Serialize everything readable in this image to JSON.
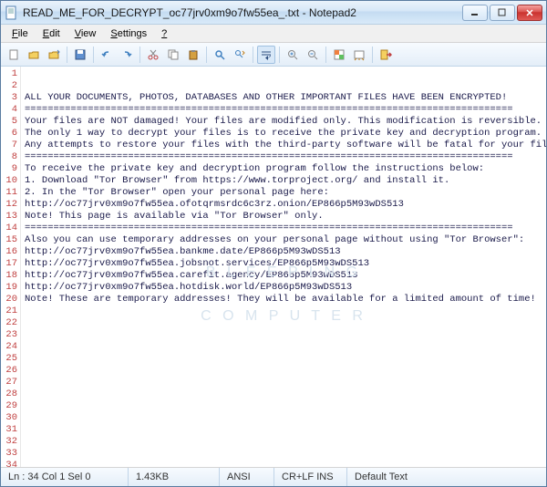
{
  "window": {
    "title": "READ_ME_FOR_DECRYPT_oc77jrv0xm9o7fw55ea_.txt - Notepad2"
  },
  "menu": {
    "file": "File",
    "edit": "Edit",
    "view": "View",
    "settings": "Settings",
    "help": "?"
  },
  "toolbar_icons": {
    "new": "new-icon",
    "open": "open-icon",
    "history": "history-icon",
    "save": "save-icon",
    "undo": "undo-icon",
    "redo": "redo-icon",
    "cut": "cut-icon",
    "copy": "copy-icon",
    "paste": "paste-icon",
    "find": "find-icon",
    "replace": "replace-icon",
    "wrap": "wrap-icon",
    "zoomin": "zoomin-icon",
    "zoomout": "zoomout-icon",
    "scheme": "scheme-icon",
    "config": "config-icon",
    "exit": "exit-icon"
  },
  "lines": [
    "ALL YOUR DOCUMENTS, PHOTOS, DATABASES AND OTHER IMPORTANT FILES HAVE BEEN ENCRYPTED!",
    "",
    "=====================================================================================",
    "Your files are NOT damaged! Your files are modified only. This modification is reversible.",
    "",
    "The only 1 way to decrypt your files is to receive the private key and decryption program.",
    "",
    "Any attempts to restore your files with the third-party software will be fatal for your files!",
    "",
    "=====================================================================================",
    "To receive the private key and decryption program follow the instructions below:",
    "",
    "1. Download \"Tor Browser\" from https://www.torproject.org/ and install it.",
    "",
    "2. In the \"Tor Browser\" open your personal page here:",
    "",
    "",
    "http://oc77jrv0xm9o7fw55ea.ofotqrmsrdc6c3rz.onion/EP866p5M93wDS513",
    "",
    "",
    "Note! This page is available via \"Tor Browser\" only.",
    "",
    "=====================================================================================",
    "Also you can use temporary addresses on your personal page without using \"Tor Browser\":",
    "",
    "",
    "http://oc77jrv0xm9o7fw55ea.bankme.date/EP866p5M93wDS513",
    "",
    "http://oc77jrv0xm9o7fw55ea.jobsnot.services/EP866p5M93wDS513",
    "",
    "http://oc77jrv0xm9o7fw55ea.carefit.agency/EP866p5M93wDS513",
    "",
    "http://oc77jrv0xm9o7fw55ea.hotdisk.world/EP866p5M93wDS513",
    "",
    "",
    "Note! These are temporary addresses! They will be available for a limited amount of time!",
    ""
  ],
  "status": {
    "pos": "Ln : 34   Col 1   Sel 0",
    "size": "1.43KB",
    "enc": "ANSI",
    "eol": "CR+LF  INS",
    "scheme": "Default Text"
  },
  "watermark": {
    "l1": "B L E E P I N G",
    "l2": "C O M P U T E R"
  }
}
